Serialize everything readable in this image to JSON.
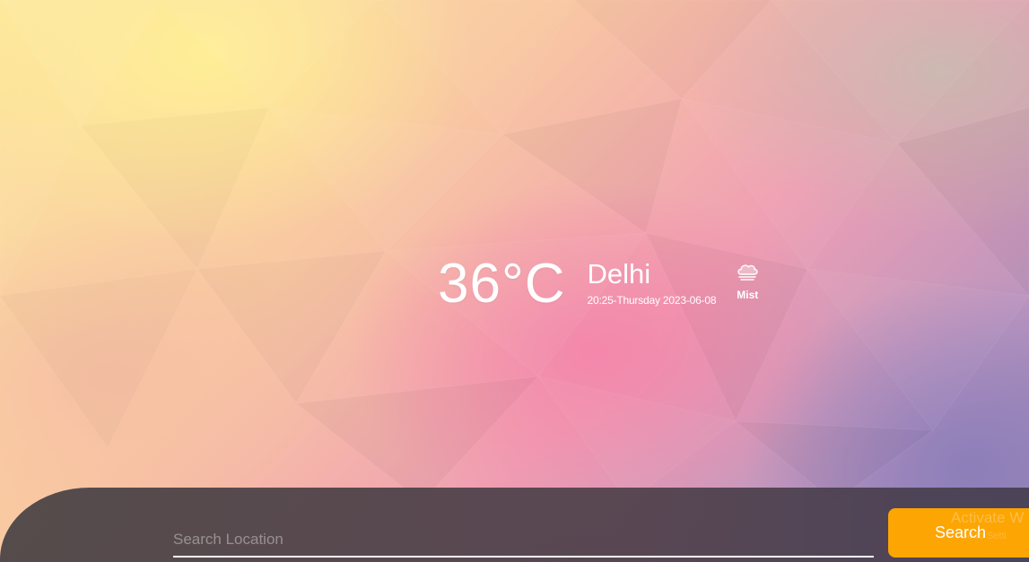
{
  "weather": {
    "temperature": "36°C",
    "city": "Delhi",
    "datetime": "20:25-Thursday 2023-06-08",
    "condition": "Mist",
    "condition_icon": "cloud-icon"
  },
  "search": {
    "placeholder": "Search Location",
    "value": "",
    "button_label": "Search"
  },
  "watermark": {
    "line1": "Activate W",
    "line2": "Go to Setti"
  }
}
